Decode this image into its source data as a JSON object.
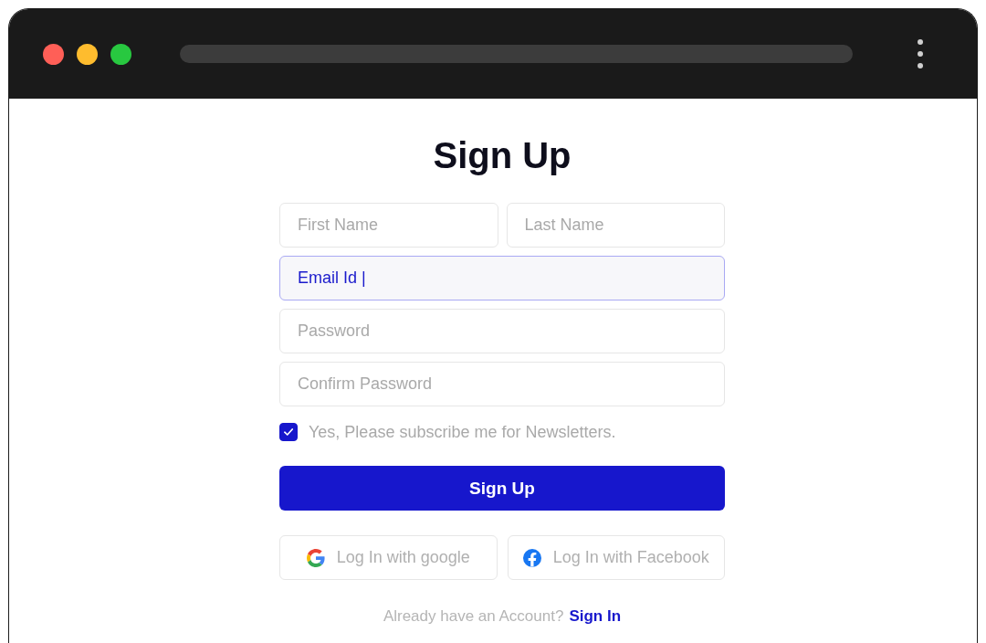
{
  "form": {
    "title": "Sign Up",
    "rows": [
      {
        "fields": [
          {
            "placeholder": "First Name",
            "focused": false
          },
          {
            "placeholder": "Last Name",
            "focused": false
          }
        ]
      },
      {
        "fields": [
          {
            "value": "Email Id |",
            "focused": true
          }
        ]
      },
      {
        "fields": [
          {
            "placeholder": "Password",
            "focused": false
          }
        ]
      },
      {
        "fields": [
          {
            "placeholder": "Confirm Password",
            "focused": false
          }
        ]
      }
    ],
    "newsletter": {
      "label": "Yes, Please subscribe me for Newsletters.",
      "checked": true
    },
    "submit_button": "Sign Up",
    "social_buttons": [
      {
        "kind": "google",
        "label": "Log In with google"
      },
      {
        "kind": "facebook",
        "label": "Log In with Facebook"
      }
    ],
    "footer": {
      "prompt": "Already have an Account?",
      "link": "Sign In"
    }
  }
}
